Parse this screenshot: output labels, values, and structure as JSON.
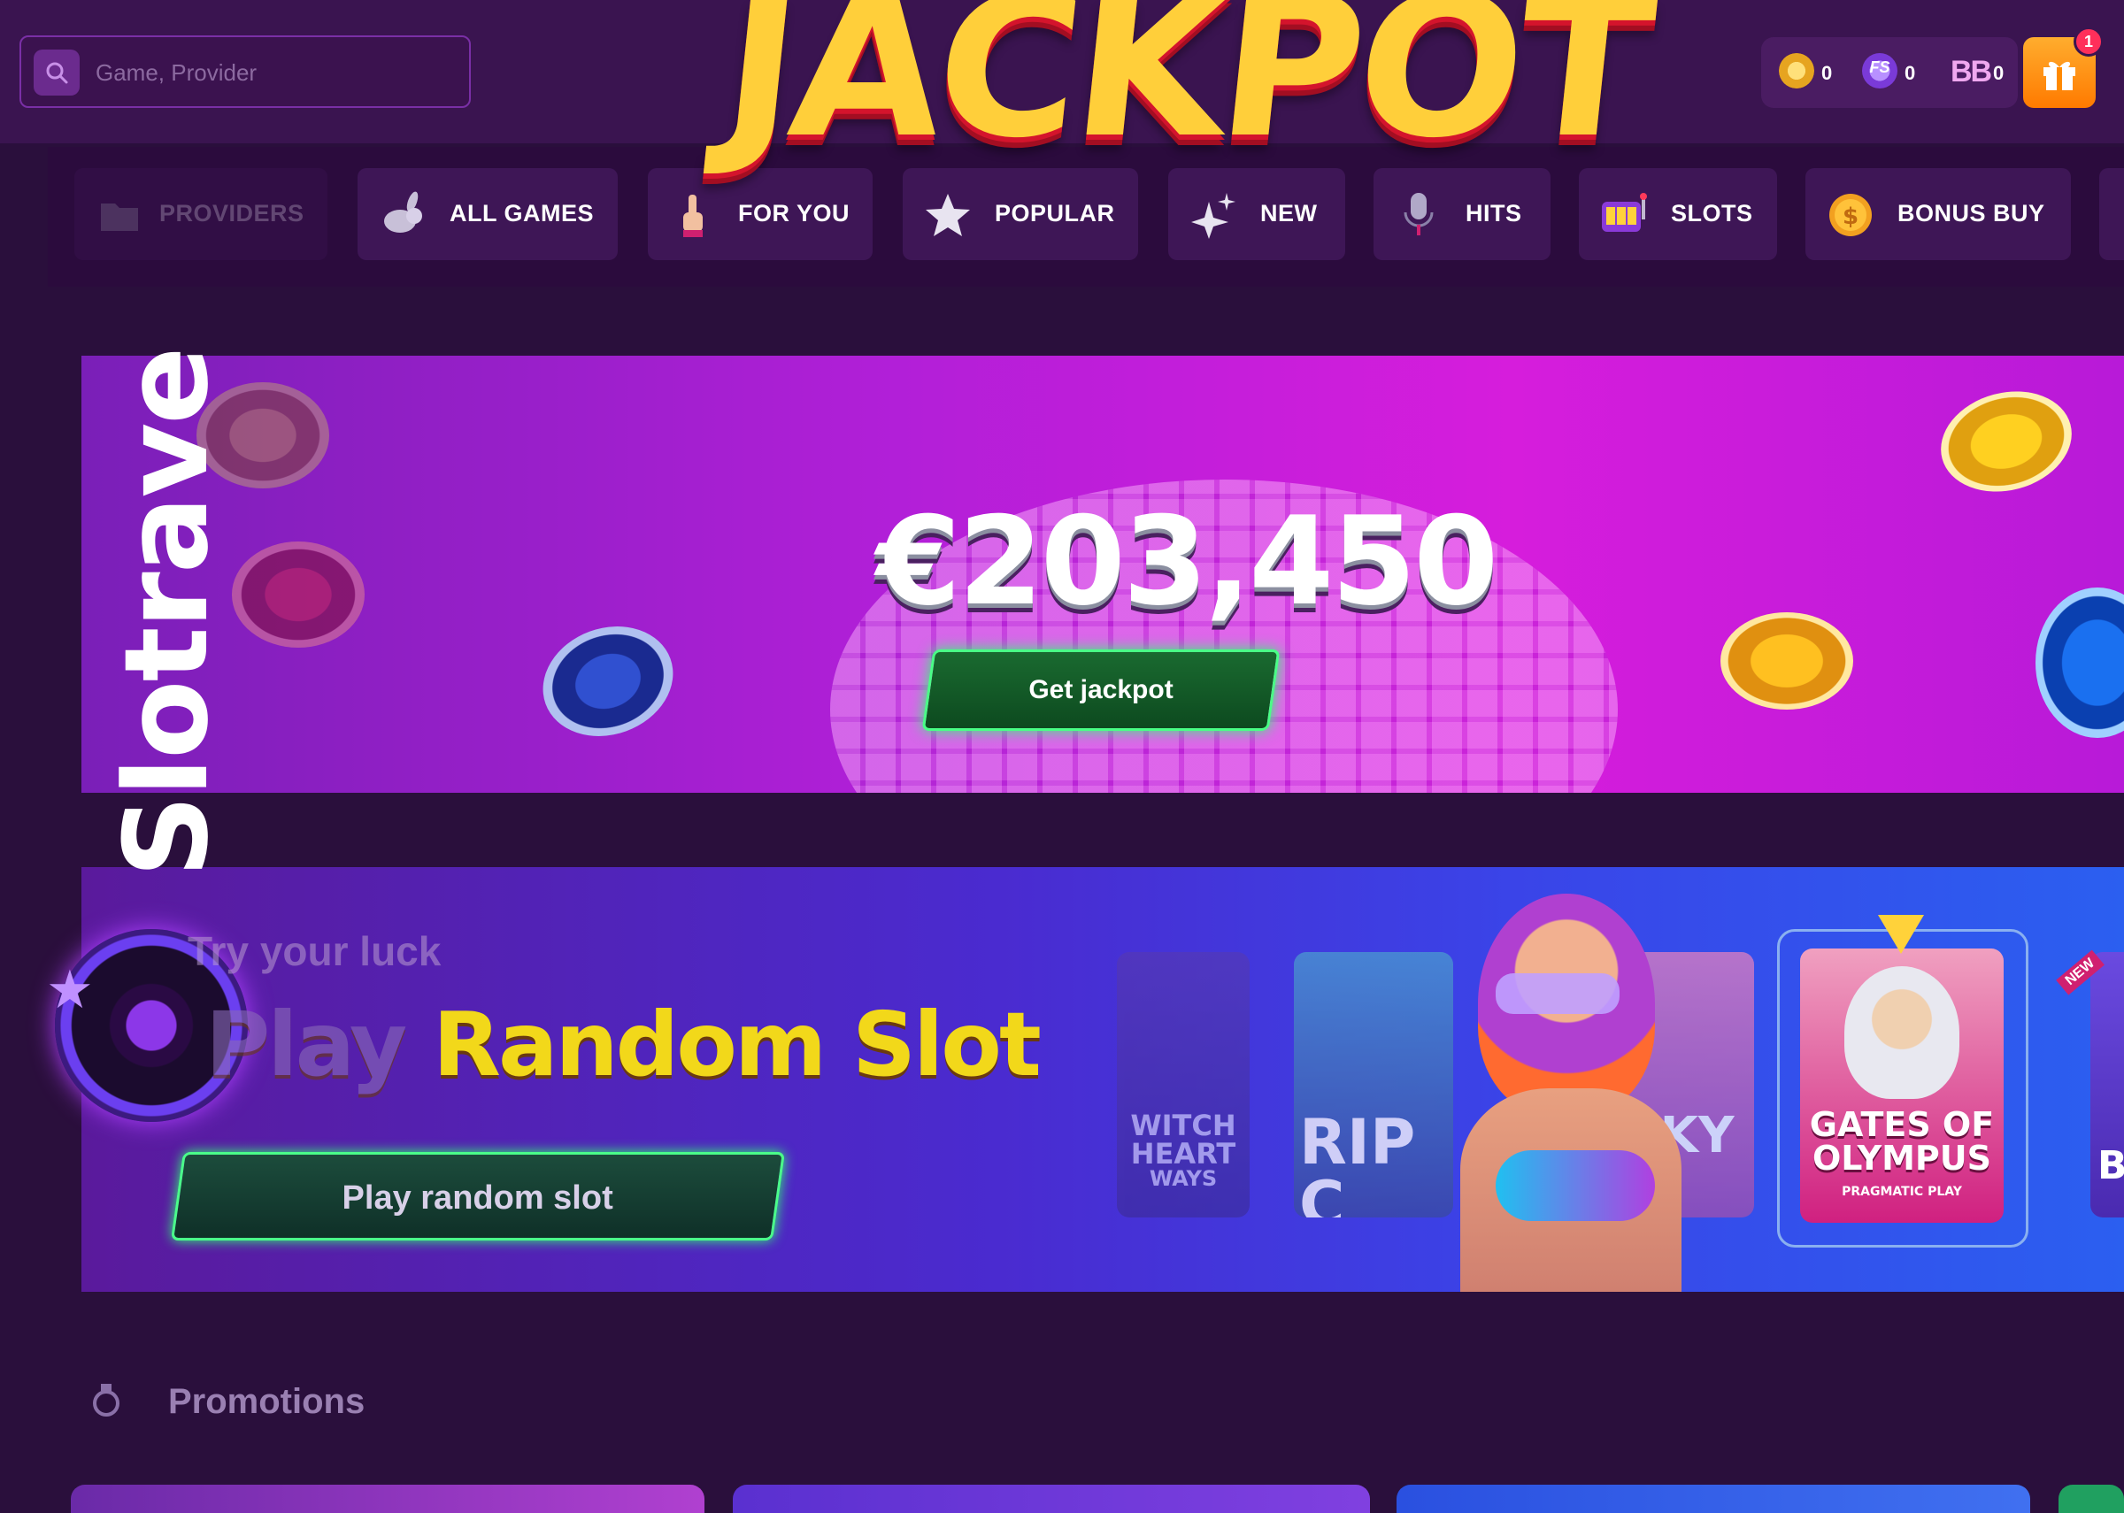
{
  "search": {
    "placeholder": "Game, Provider"
  },
  "balances": {
    "bonus_coins": "0",
    "free_spins_label": "FS",
    "free_spins": "0",
    "bonus_buy_label": "BB",
    "bonus_buy": "0"
  },
  "gift": {
    "badge": "1"
  },
  "categories": [
    {
      "label": "PROVIDERS",
      "icon": "folder-icon"
    },
    {
      "label": "ALL GAMES",
      "icon": "rabbit-icon"
    },
    {
      "label": "FOR YOU",
      "icon": "pointing-finger-icon"
    },
    {
      "label": "POPULAR",
      "icon": "star-icon"
    },
    {
      "label": "NEW",
      "icon": "sparkle-icon"
    },
    {
      "label": "HITS",
      "icon": "microphone-icon"
    },
    {
      "label": "SLOTS",
      "icon": "slot-machine-icon"
    },
    {
      "label": "BONUS BUY",
      "icon": "dollar-coin-icon"
    }
  ],
  "jackpot": {
    "title": "JACKPOT",
    "amount": "€203,450",
    "button": "Get jackpot"
  },
  "brand": "Slotrave",
  "random_slot": {
    "kicker": "Try your luck",
    "title_faded": "Play",
    "title_main": "Random Slot",
    "button": "Play random slot",
    "cards": [
      {
        "title": "WITCH HEART MEGAWAYS",
        "line1": "WITCH",
        "line2": "HEART",
        "line3": "WAYS"
      },
      {
        "title": "RIP CITY",
        "line1": "RIP C"
      },
      {
        "title": "LUCKY",
        "line1": "CKY"
      },
      {
        "title": "GATES OF OLYMPUS",
        "line1": "GATES OF",
        "line2": "OLYMPUS",
        "provider": "PRAGMATIC PLAY"
      },
      {
        "title": "BO",
        "line1": "BO",
        "badge": "NEW"
      }
    ]
  },
  "promotions": {
    "title": "Promotions"
  },
  "colors": {
    "background": "#2a0f3c",
    "accent_green": "#49ff86",
    "gift_orange": "#ff8a00",
    "jackpot_gold": "#ffcf3a"
  }
}
